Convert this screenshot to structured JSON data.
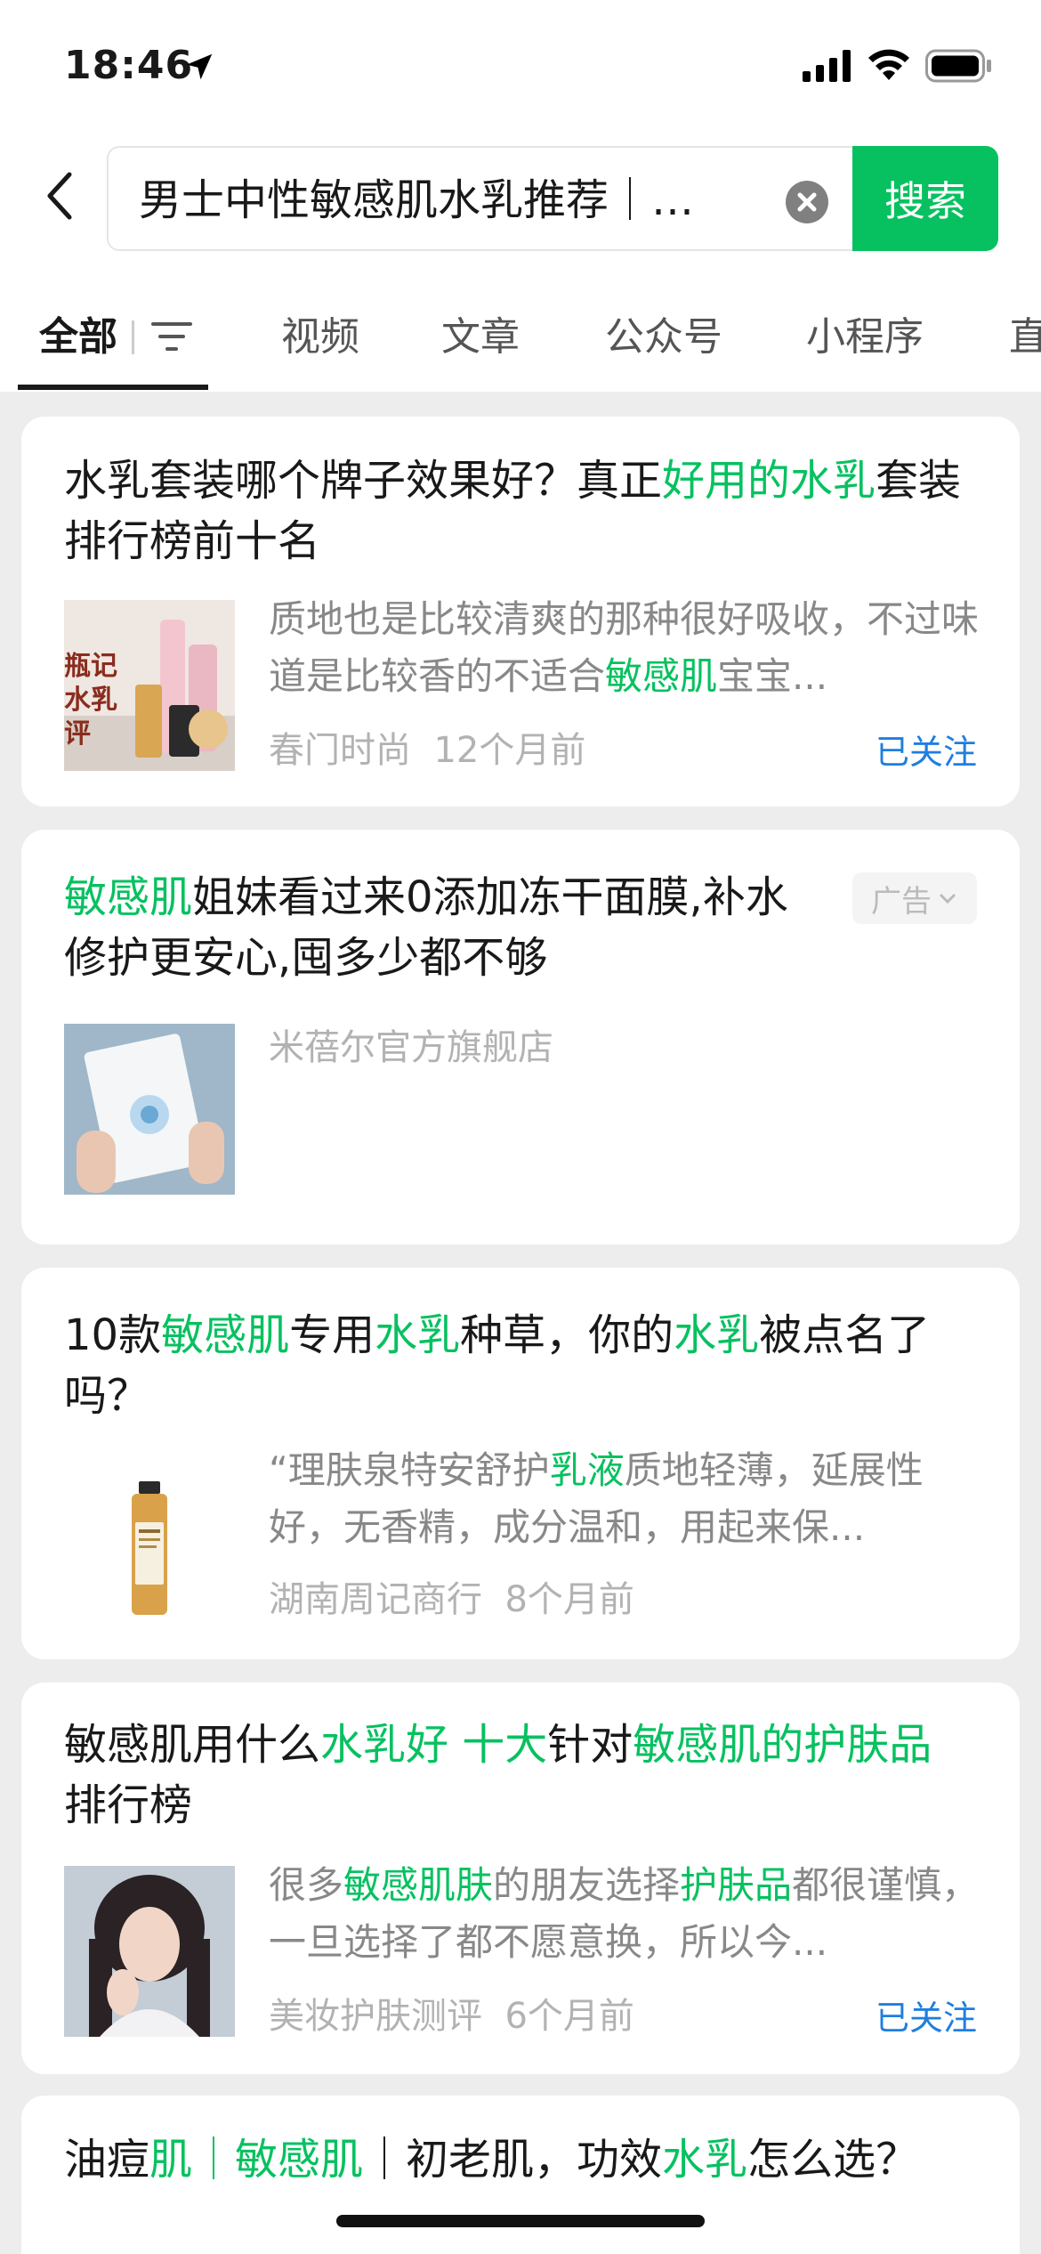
{
  "status_bar": {
    "time": "18:46"
  },
  "search": {
    "query": "男士中性敏感肌水乳推荐｜…",
    "button_label": "搜索"
  },
  "tabs": [
    "全部",
    "视频",
    "文章",
    "公众号",
    "小程序",
    "直"
  ],
  "results": [
    {
      "title_parts": [
        {
          "text": "水乳套装哪个牌子效果好？真正",
          "hl": false
        },
        {
          "text": "好用的水乳",
          "hl": true
        },
        {
          "text": "套装排行榜前十名",
          "hl": false
        }
      ],
      "thumb_caption": [
        "瓶记",
        "水乳",
        "评"
      ],
      "desc_parts": [
        {
          "text": "质地也是比较清爽的那种很好吸收，不过味道是比较香的不适合",
          "hl": false
        },
        {
          "text": "敏感肌",
          "hl": true
        },
        {
          "text": "宝宝...",
          "hl": false
        }
      ],
      "source": "春门时尚",
      "time_ago": "12个月前",
      "follow_label": "已关注"
    },
    {
      "title_parts": [
        {
          "text": "敏感肌",
          "hl": true
        },
        {
          "text": "姐妹看过来0添加冻干面膜,补水修护更安心,囤多少都不够",
          "hl": false
        }
      ],
      "source": "米蓓尔官方旗舰店",
      "ad_label": "广告"
    },
    {
      "title_parts": [
        {
          "text": "10款",
          "hl": false
        },
        {
          "text": "敏感肌",
          "hl": true
        },
        {
          "text": "专用",
          "hl": false
        },
        {
          "text": "水乳",
          "hl": true
        },
        {
          "text": "种草，你的",
          "hl": false
        },
        {
          "text": "水乳",
          "hl": true
        },
        {
          "text": "被点名了吗？",
          "hl": false
        }
      ],
      "desc_parts": [
        {
          "text": "“理肤泉特安舒护",
          "hl": false
        },
        {
          "text": "乳液",
          "hl": true
        },
        {
          "text": "质地轻薄，延展性好，无香精，成分温和，用起来保...",
          "hl": false
        }
      ],
      "source": "湖南周记商行",
      "time_ago": "8个月前"
    },
    {
      "title_parts": [
        {
          "text": "敏感肌用什么",
          "hl": false
        },
        {
          "text": "水乳好 十大",
          "hl": true
        },
        {
          "text": "针对",
          "hl": false
        },
        {
          "text": "敏感肌的护肤品",
          "hl": true
        },
        {
          "text": "排行榜",
          "hl": false
        }
      ],
      "desc_parts": [
        {
          "text": "很多",
          "hl": false
        },
        {
          "text": "敏感肌肤",
          "hl": true
        },
        {
          "text": "的朋友选择",
          "hl": false
        },
        {
          "text": "护肤品",
          "hl": true
        },
        {
          "text": "都很谨慎，一旦选择了都不愿意换，所以今...",
          "hl": false
        }
      ],
      "source": "美妆护肤测评",
      "time_ago": "6个月前",
      "follow_label": "已关注"
    },
    {
      "title_parts": [
        {
          "text": "油痘",
          "hl": false
        },
        {
          "text": "肌｜敏感肌",
          "hl": true
        },
        {
          "text": "｜初老肌，功效",
          "hl": false
        },
        {
          "text": "水乳",
          "hl": true
        },
        {
          "text": "怎么选？",
          "hl": false
        }
      ]
    }
  ],
  "colors": {
    "accent": "#07c160",
    "link": "#1f7ee0",
    "muted": "#b2b2b2",
    "background": "#ededed"
  }
}
